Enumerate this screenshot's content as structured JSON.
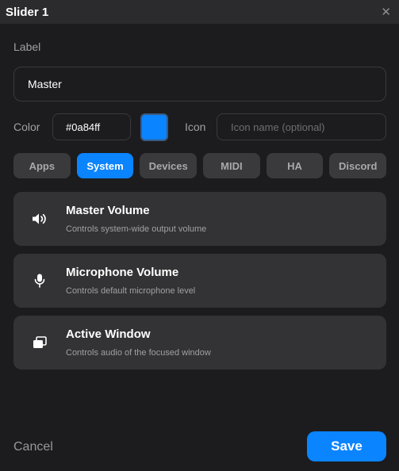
{
  "window": {
    "title": "Slider 1",
    "close_glyph": "✕"
  },
  "form": {
    "label_caption": "Label",
    "label_value": "Master",
    "color_caption": "Color",
    "color_value": "#0a84ff",
    "swatch_color": "#0a84ff",
    "icon_caption": "Icon",
    "icon_placeholder": "Icon name (optional)"
  },
  "tabs": [
    {
      "label": "Apps",
      "active": false
    },
    {
      "label": "System",
      "active": true
    },
    {
      "label": "Devices",
      "active": false
    },
    {
      "label": "MIDI",
      "active": false
    },
    {
      "label": "HA",
      "active": false
    },
    {
      "label": "Discord",
      "active": false
    }
  ],
  "targets": [
    {
      "title": "Master Volume",
      "description": "Controls system-wide output volume",
      "icon": "speaker-icon"
    },
    {
      "title": "Microphone Volume",
      "description": "Controls default microphone level",
      "icon": "microphone-icon"
    },
    {
      "title": "Active Window",
      "description": "Controls audio of the focused window",
      "icon": "window-stack-icon"
    }
  ],
  "footer": {
    "cancel_label": "Cancel",
    "save_label": "Save"
  },
  "colors": {
    "accent": "#0a84ff",
    "background": "#1c1c1e",
    "card": "#333335",
    "tab_inactive": "#3a3a3c"
  }
}
